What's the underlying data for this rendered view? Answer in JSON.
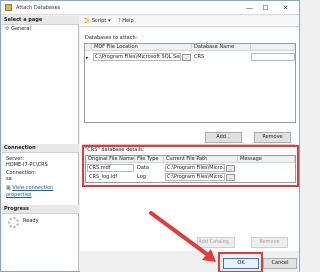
{
  "window": {
    "title": "Attach Databases",
    "minimize": "—",
    "maximize": "☐",
    "close": "✕"
  },
  "left": {
    "select_page_header": "Select a page",
    "pages": [
      {
        "label": "General"
      }
    ],
    "connection_header": "Connection",
    "server_label": "Server:",
    "server_value": "HOME-I7-PC\\CRS",
    "connection_label": "Connection:",
    "connection_value": "sa",
    "view_props_link": "View connection properties",
    "progress_header": "Progress",
    "progress_status": "Ready"
  },
  "toolbar": {
    "script_label": "Script",
    "help_label": "Help"
  },
  "attach_section": {
    "label": "Databases to attach:",
    "columns": [
      "MDF File Location",
      "Database Name"
    ],
    "row": {
      "mdf": "C:\\Program Files\\Microsoft SQL Server\\MSSQL...",
      "db": "CRS"
    },
    "add_button": "Add...",
    "remove_button": "Remove"
  },
  "details_section": {
    "label": "\"CRS\" database details:",
    "columns": [
      "Original File Name",
      "File Type",
      "Current File Path",
      "Message"
    ],
    "rows": [
      {
        "name": "CRS.mdf",
        "type": "Data",
        "path": "C:\\Program Files\\Micro..."
      },
      {
        "name": "CRS_log.ldf",
        "type": "Log",
        "path": "C:\\Program Files\\Micro..."
      }
    ],
    "add_catalog_button": "Add Catalog...",
    "remove_button": "Remove"
  },
  "footer": {
    "ok_button": "OK",
    "cancel_button": "Cancel"
  },
  "colors": {
    "highlight": "#e03c3c",
    "link": "#1a5fb4"
  }
}
